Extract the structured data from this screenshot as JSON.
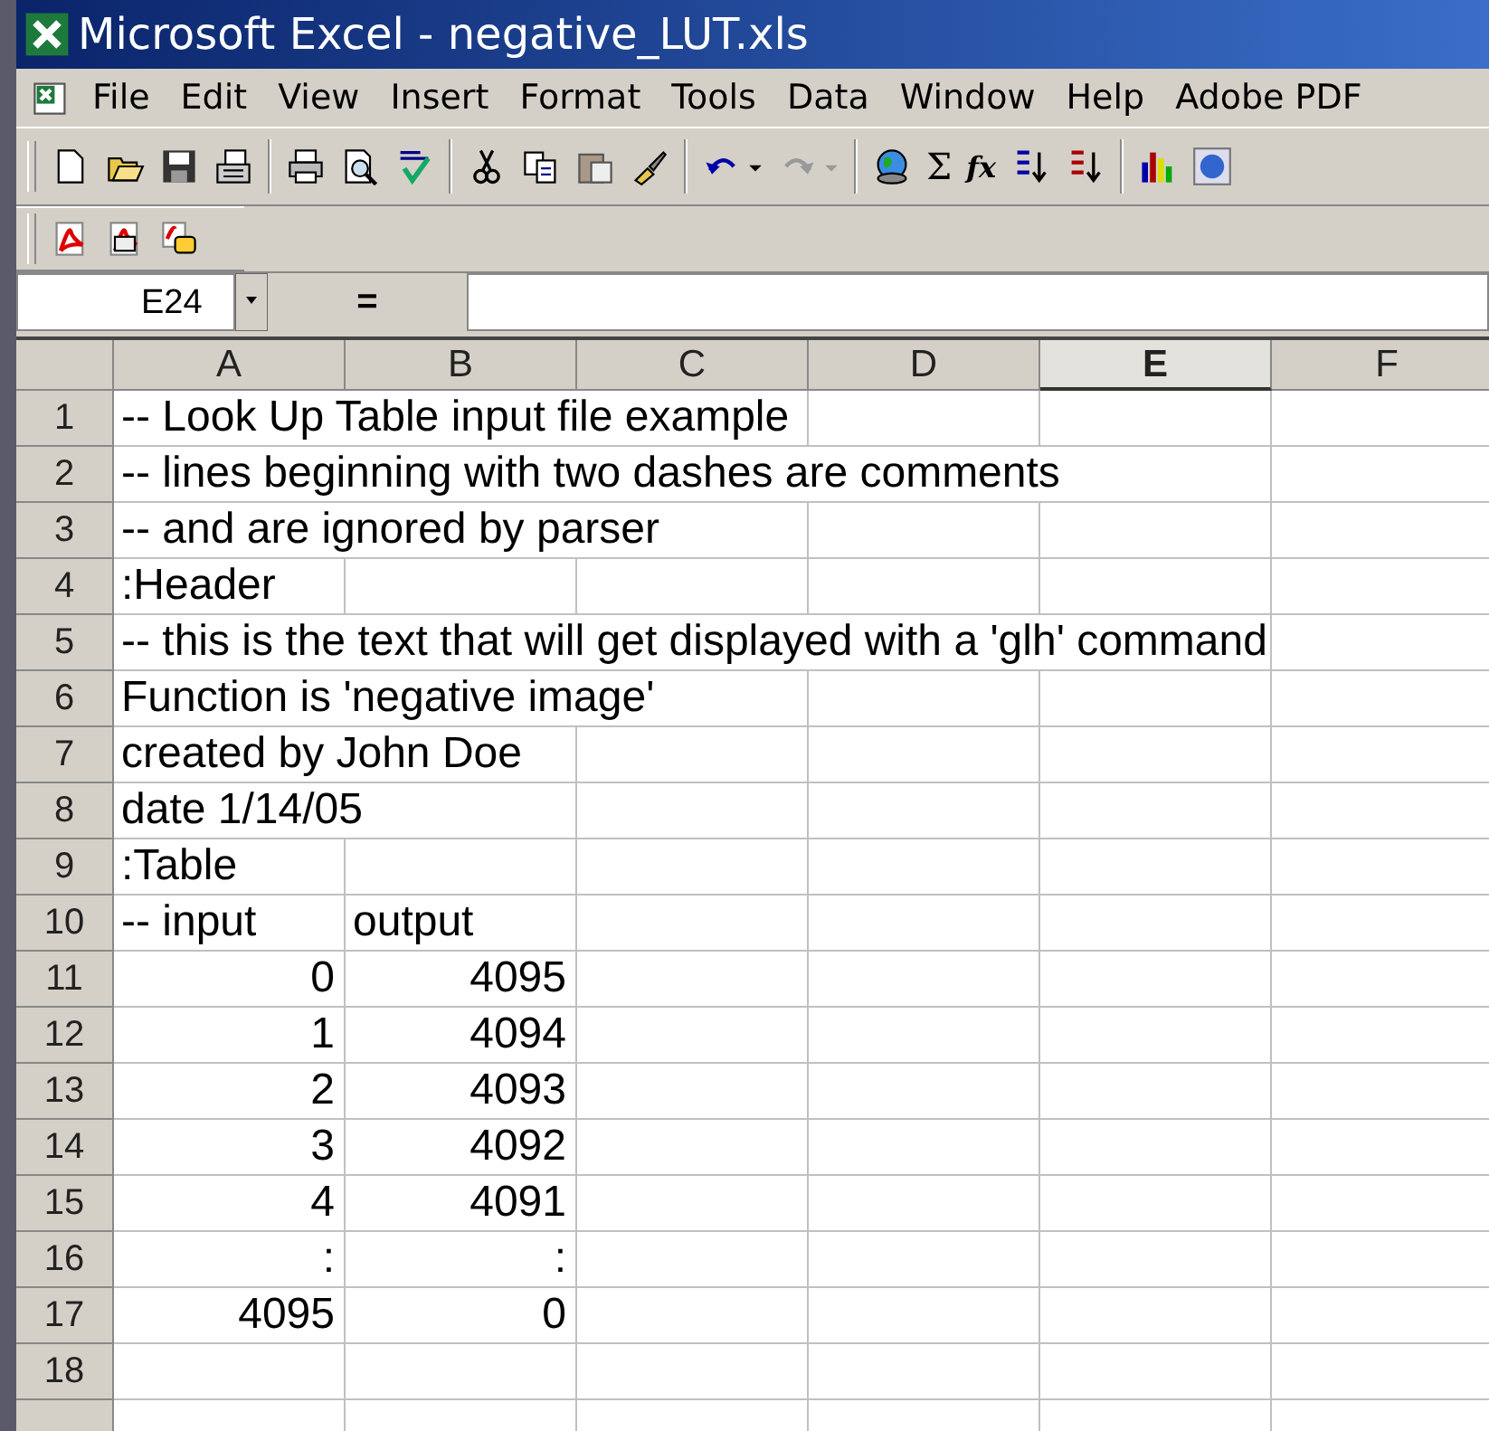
{
  "window": {
    "title": "Microsoft Excel - negative_LUT.xls"
  },
  "menu": [
    {
      "label": "File"
    },
    {
      "label": "Edit"
    },
    {
      "label": "View"
    },
    {
      "label": "Insert"
    },
    {
      "label": "Format"
    },
    {
      "label": "Tools"
    },
    {
      "label": "Data"
    },
    {
      "label": "Window"
    },
    {
      "label": "Help"
    },
    {
      "label": "Adobe PDF"
    }
  ],
  "toolbar": {
    "sum_glyph": "Σ",
    "function_glyph": "fx"
  },
  "formula_bar": {
    "name_box": "E24",
    "equals": "="
  },
  "columns": [
    {
      "label": "A",
      "selected": false
    },
    {
      "label": "B",
      "selected": false
    },
    {
      "label": "C",
      "selected": false
    },
    {
      "label": "D",
      "selected": false
    },
    {
      "label": "E",
      "selected": true
    },
    {
      "label": "F",
      "selected": false
    }
  ],
  "rows": [
    {
      "label": "1",
      "a": {
        "text": "-- Look Up Table input file example",
        "kind": "text"
      }
    },
    {
      "label": "2",
      "a": {
        "text": "-- lines beginning with two dashes are comments",
        "kind": "text"
      }
    },
    {
      "label": "3",
      "a": {
        "text": "-- and are ignored by parser",
        "kind": "text"
      }
    },
    {
      "label": "4",
      "a": {
        "text": ":Header",
        "kind": "text"
      }
    },
    {
      "label": "5",
      "a": {
        "text": "-- this is the text that will get displayed with a 'glh' command",
        "kind": "text"
      }
    },
    {
      "label": "6",
      "a": {
        "text": "Function is 'negative image'",
        "kind": "text"
      }
    },
    {
      "label": "7",
      "a": {
        "text": "created by John Doe",
        "kind": "text"
      }
    },
    {
      "label": "8",
      "a": {
        "text": "date 1/14/05",
        "kind": "text"
      }
    },
    {
      "label": "9",
      "a": {
        "text": ":Table",
        "kind": "text"
      }
    },
    {
      "label": "10",
      "a": {
        "text": "-- input",
        "kind": "text"
      },
      "b": {
        "text": "output",
        "kind": "text"
      }
    },
    {
      "label": "11",
      "a": {
        "text": "0",
        "kind": "number"
      },
      "b": {
        "text": "4095",
        "kind": "number"
      }
    },
    {
      "label": "12",
      "a": {
        "text": "1",
        "kind": "number"
      },
      "b": {
        "text": "4094",
        "kind": "number"
      }
    },
    {
      "label": "13",
      "a": {
        "text": "2",
        "kind": "number"
      },
      "b": {
        "text": "4093",
        "kind": "number"
      }
    },
    {
      "label": "14",
      "a": {
        "text": "3",
        "kind": "number"
      },
      "b": {
        "text": "4092",
        "kind": "number"
      }
    },
    {
      "label": "15",
      "a": {
        "text": "4",
        "kind": "number"
      },
      "b": {
        "text": "4091",
        "kind": "number"
      }
    },
    {
      "label": "16",
      "a": {
        "text": ":",
        "kind": "number"
      },
      "b": {
        "text": ":",
        "kind": "number"
      }
    },
    {
      "label": "17",
      "a": {
        "text": "4095",
        "kind": "number"
      },
      "b": {
        "text": "0",
        "kind": "number"
      }
    },
    {
      "label": "18"
    },
    {}
  ]
}
